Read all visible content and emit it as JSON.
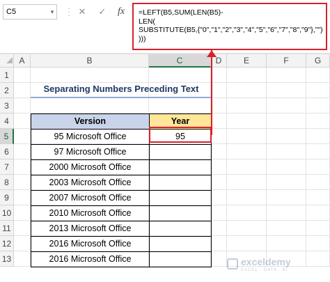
{
  "name_box": "C5",
  "formula_bar": {
    "formula": "=LEFT(B5,SUM(LEN(B5)-\nLEN(\nSUBSTITUTE(B5,{\"0\",\"1\",\"2\",\"3\",\"4\",\"5\",\"6\",\"7\",\"8\",\"9\"},\"\")\n)))",
    "cancel_icon": "✕",
    "enter_icon": "✓",
    "fx_label": "fx"
  },
  "columns": [
    "A",
    "B",
    "C",
    "D",
    "E",
    "F",
    "G"
  ],
  "rows": [
    "1",
    "2",
    "3",
    "4",
    "5",
    "6",
    "7",
    "8",
    "9",
    "10",
    "11",
    "12",
    "13"
  ],
  "selected_cell": "C5",
  "title": "Separating Numbers Preceding Text",
  "table": {
    "headers": [
      "Version",
      "Year"
    ],
    "rows": [
      {
        "version": "95 Microsoft Office",
        "year": "95"
      },
      {
        "version": "97 Microsoft Office",
        "year": ""
      },
      {
        "version": "2000 Microsoft Office",
        "year": ""
      },
      {
        "version": "2003 Microsoft Office",
        "year": ""
      },
      {
        "version": "2007 Microsoft Office",
        "year": ""
      },
      {
        "version": "2010 Microsoft Office",
        "year": ""
      },
      {
        "version": "2013 Microsoft Office",
        "year": ""
      },
      {
        "version": "2016 Microsoft Office",
        "year": ""
      },
      {
        "version": "2016 Microsoft Office",
        "year": ""
      }
    ]
  },
  "watermark": {
    "name": "exceldemy",
    "tagline": "EXCEL · DATA · BI"
  },
  "colors": {
    "highlight": "#d8202b",
    "header_version": "#c9d4ea",
    "header_year": "#ffe699",
    "title": "#203864"
  }
}
